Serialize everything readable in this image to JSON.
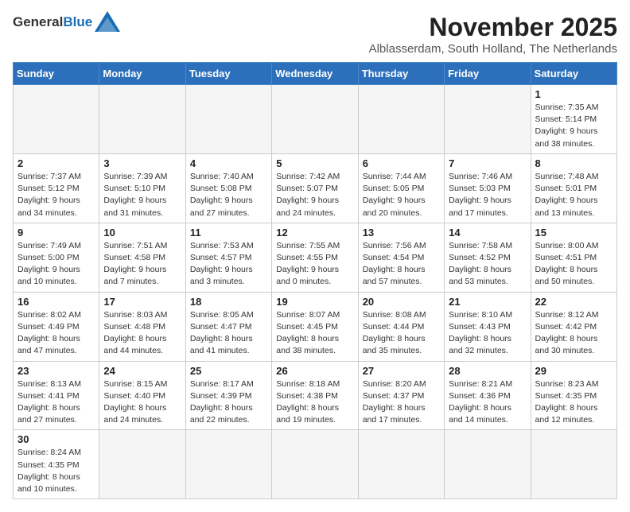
{
  "header": {
    "logo_general": "General",
    "logo_blue": "Blue",
    "month_year": "November 2025",
    "location": "Alblasserdam, South Holland, The Netherlands"
  },
  "weekdays": [
    "Sunday",
    "Monday",
    "Tuesday",
    "Wednesday",
    "Thursday",
    "Friday",
    "Saturday"
  ],
  "days": [
    {
      "date": "",
      "info": ""
    },
    {
      "date": "",
      "info": ""
    },
    {
      "date": "",
      "info": ""
    },
    {
      "date": "",
      "info": ""
    },
    {
      "date": "",
      "info": ""
    },
    {
      "date": "",
      "info": ""
    },
    {
      "date": "1",
      "info": "Sunrise: 7:35 AM\nSunset: 5:14 PM\nDaylight: 9 hours\nand 38 minutes."
    },
    {
      "date": "2",
      "info": "Sunrise: 7:37 AM\nSunset: 5:12 PM\nDaylight: 9 hours\nand 34 minutes."
    },
    {
      "date": "3",
      "info": "Sunrise: 7:39 AM\nSunset: 5:10 PM\nDaylight: 9 hours\nand 31 minutes."
    },
    {
      "date": "4",
      "info": "Sunrise: 7:40 AM\nSunset: 5:08 PM\nDaylight: 9 hours\nand 27 minutes."
    },
    {
      "date": "5",
      "info": "Sunrise: 7:42 AM\nSunset: 5:07 PM\nDaylight: 9 hours\nand 24 minutes."
    },
    {
      "date": "6",
      "info": "Sunrise: 7:44 AM\nSunset: 5:05 PM\nDaylight: 9 hours\nand 20 minutes."
    },
    {
      "date": "7",
      "info": "Sunrise: 7:46 AM\nSunset: 5:03 PM\nDaylight: 9 hours\nand 17 minutes."
    },
    {
      "date": "8",
      "info": "Sunrise: 7:48 AM\nSunset: 5:01 PM\nDaylight: 9 hours\nand 13 minutes."
    },
    {
      "date": "9",
      "info": "Sunrise: 7:49 AM\nSunset: 5:00 PM\nDaylight: 9 hours\nand 10 minutes."
    },
    {
      "date": "10",
      "info": "Sunrise: 7:51 AM\nSunset: 4:58 PM\nDaylight: 9 hours\nand 7 minutes."
    },
    {
      "date": "11",
      "info": "Sunrise: 7:53 AM\nSunset: 4:57 PM\nDaylight: 9 hours\nand 3 minutes."
    },
    {
      "date": "12",
      "info": "Sunrise: 7:55 AM\nSunset: 4:55 PM\nDaylight: 9 hours\nand 0 minutes."
    },
    {
      "date": "13",
      "info": "Sunrise: 7:56 AM\nSunset: 4:54 PM\nDaylight: 8 hours\nand 57 minutes."
    },
    {
      "date": "14",
      "info": "Sunrise: 7:58 AM\nSunset: 4:52 PM\nDaylight: 8 hours\nand 53 minutes."
    },
    {
      "date": "15",
      "info": "Sunrise: 8:00 AM\nSunset: 4:51 PM\nDaylight: 8 hours\nand 50 minutes."
    },
    {
      "date": "16",
      "info": "Sunrise: 8:02 AM\nSunset: 4:49 PM\nDaylight: 8 hours\nand 47 minutes."
    },
    {
      "date": "17",
      "info": "Sunrise: 8:03 AM\nSunset: 4:48 PM\nDaylight: 8 hours\nand 44 minutes."
    },
    {
      "date": "18",
      "info": "Sunrise: 8:05 AM\nSunset: 4:47 PM\nDaylight: 8 hours\nand 41 minutes."
    },
    {
      "date": "19",
      "info": "Sunrise: 8:07 AM\nSunset: 4:45 PM\nDaylight: 8 hours\nand 38 minutes."
    },
    {
      "date": "20",
      "info": "Sunrise: 8:08 AM\nSunset: 4:44 PM\nDaylight: 8 hours\nand 35 minutes."
    },
    {
      "date": "21",
      "info": "Sunrise: 8:10 AM\nSunset: 4:43 PM\nDaylight: 8 hours\nand 32 minutes."
    },
    {
      "date": "22",
      "info": "Sunrise: 8:12 AM\nSunset: 4:42 PM\nDaylight: 8 hours\nand 30 minutes."
    },
    {
      "date": "23",
      "info": "Sunrise: 8:13 AM\nSunset: 4:41 PM\nDaylight: 8 hours\nand 27 minutes."
    },
    {
      "date": "24",
      "info": "Sunrise: 8:15 AM\nSunset: 4:40 PM\nDaylight: 8 hours\nand 24 minutes."
    },
    {
      "date": "25",
      "info": "Sunrise: 8:17 AM\nSunset: 4:39 PM\nDaylight: 8 hours\nand 22 minutes."
    },
    {
      "date": "26",
      "info": "Sunrise: 8:18 AM\nSunset: 4:38 PM\nDaylight: 8 hours\nand 19 minutes."
    },
    {
      "date": "27",
      "info": "Sunrise: 8:20 AM\nSunset: 4:37 PM\nDaylight: 8 hours\nand 17 minutes."
    },
    {
      "date": "28",
      "info": "Sunrise: 8:21 AM\nSunset: 4:36 PM\nDaylight: 8 hours\nand 14 minutes."
    },
    {
      "date": "29",
      "info": "Sunrise: 8:23 AM\nSunset: 4:35 PM\nDaylight: 8 hours\nand 12 minutes."
    },
    {
      "date": "30",
      "info": "Sunrise: 8:24 AM\nSunset: 4:35 PM\nDaylight: 8 hours\nand 10 minutes."
    },
    {
      "date": "",
      "info": ""
    },
    {
      "date": "",
      "info": ""
    },
    {
      "date": "",
      "info": ""
    },
    {
      "date": "",
      "info": ""
    },
    {
      "date": "",
      "info": ""
    },
    {
      "date": "",
      "info": ""
    }
  ]
}
